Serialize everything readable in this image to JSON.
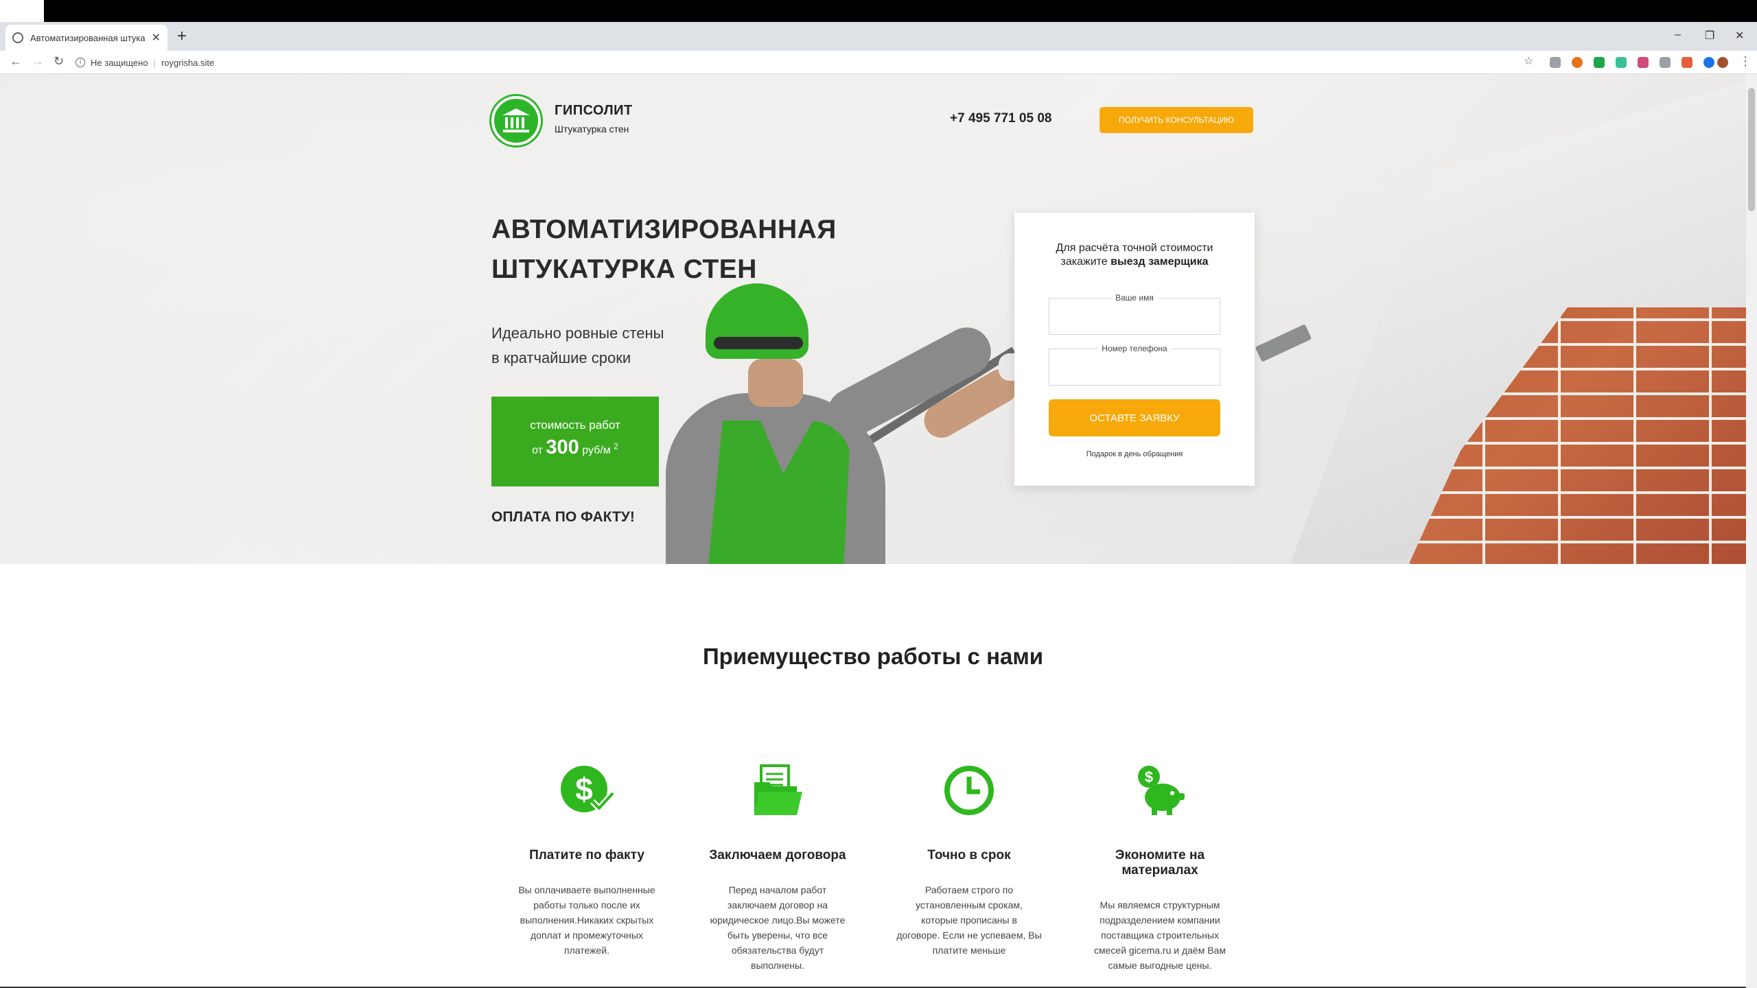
{
  "browser": {
    "tab_title": "Автоматизированная штукатур...",
    "new_tab": "+",
    "security_label": "Не защищено",
    "url": "roygrisha.site",
    "win_minimize": "–",
    "win_restore": "❐",
    "win_close": "✕"
  },
  "header": {
    "brand_name": "ГИПСОЛИТ",
    "brand_sub": "Штукатурка стен",
    "phone": "+7 495 771 05 08",
    "consult_button": "ПОЛУЧИТЬ КОНСУЛЬТАЦИЮ"
  },
  "hero": {
    "headline_1": "АВТОМАТИЗИРОВАННАЯ",
    "headline_2": "ШТУКАТУРКА СТЕН",
    "sub_1": "Идеально ровные стены",
    "sub_2": "в кратчайшие сроки",
    "price_label": "стоимость работ",
    "price_from": "от",
    "price_value": "300",
    "price_unit": "руб/м",
    "price_sup": "2",
    "payment": "ОПЛАТА ПО ФАКТУ!"
  },
  "form": {
    "title_1": "Для расчёта точной стоимости",
    "title_2_prefix": "закажите",
    "title_2_bold": "выезд замерщика",
    "name_label": "Ваше имя",
    "phone_label": "Номер телефона",
    "submit": "ОСТАВТЕ ЗАЯВКУ",
    "gift": "Подарок в день обращения"
  },
  "advantages": {
    "title": "Приемущество работы с нами",
    "items": [
      {
        "icon": "dollar-check-icon",
        "name": "Платите по факту",
        "d1": "Вы оплачиваете выполненные",
        "d2": "работы только после их",
        "d3": "выполнения.Никаких скрытых",
        "d4": "доплат и промежуточных",
        "d5": "платежей."
      },
      {
        "icon": "contract-folder-icon",
        "name": "Заключаем договора",
        "d1": "Перед началом работ",
        "d2": "заключаем договор на",
        "d3": "юридическое лицо.Вы можете",
        "d4": "быть уверены, что все",
        "d5": "обязательства будут",
        "d6": "выполнены."
      },
      {
        "icon": "clock-icon",
        "name": "Точно в срок",
        "d1": "Работаем строго по",
        "d2": "установленным срокам,",
        "d3": "которые прописаны в",
        "d4": "договоре. Если не успеваем, Вы",
        "d5": "платите меньше"
      },
      {
        "icon": "piggy-bank-icon",
        "name": "Экономите на материалах",
        "d1": "Мы являемся структурным",
        "d2": "подразделением компании",
        "d3": "поставщика строительных",
        "d4": "смесей gicema.ru и даём Вам",
        "d5": "самые выгодные цены."
      }
    ]
  },
  "colors": {
    "brand_green": "#3aaa1f",
    "accent_orange": "#f7a90b"
  }
}
